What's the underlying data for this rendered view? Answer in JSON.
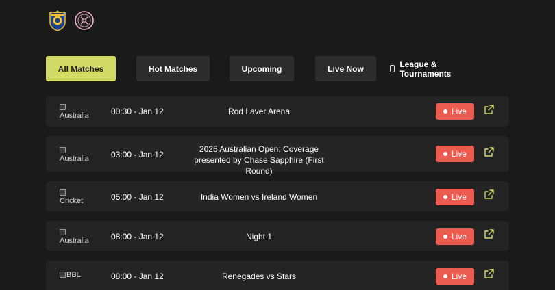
{
  "header": {
    "logos": [
      {
        "icon": "al-nassr-crest-icon"
      },
      {
        "icon": "inter-miami-crest-icon"
      }
    ]
  },
  "filters": {
    "tabs": [
      {
        "label": "All Matches",
        "active": true
      },
      {
        "label": "Hot Matches",
        "active": false
      },
      {
        "label": "Upcoming",
        "active": false
      },
      {
        "label": "Live Now",
        "active": false
      }
    ],
    "league_toggle": {
      "label": "League & Tournaments",
      "checked": false
    }
  },
  "matches": [
    {
      "logo_alt": "Australia",
      "time": "00:30 - Jan 12",
      "title": "Rod Laver Arena",
      "live_label": "Live"
    },
    {
      "logo_alt": "Australia",
      "time": "03:00 - Jan 12",
      "title": "2025 Australian Open: Coverage presented by Chase Sapphire (First Round)",
      "live_label": "Live"
    },
    {
      "logo_alt": "Cricket",
      "time": "05:00 - Jan 12",
      "title": "India Women vs Ireland Women",
      "live_label": "Live"
    },
    {
      "logo_alt": "Australia",
      "time": "08:00 - Jan 12",
      "title": "Night 1",
      "live_label": "Live"
    },
    {
      "logo_alt": "BBL",
      "time": "08:00 - Jan 12",
      "title": "Renegades vs Stars",
      "live_label": "Live"
    }
  ],
  "colors": {
    "background": "#1a1a1a",
    "card": "#242424",
    "button": "#2d2d2d",
    "active_tab": "#d2d964",
    "live": "#ec5b4f",
    "link_icon": "#d2d964"
  }
}
